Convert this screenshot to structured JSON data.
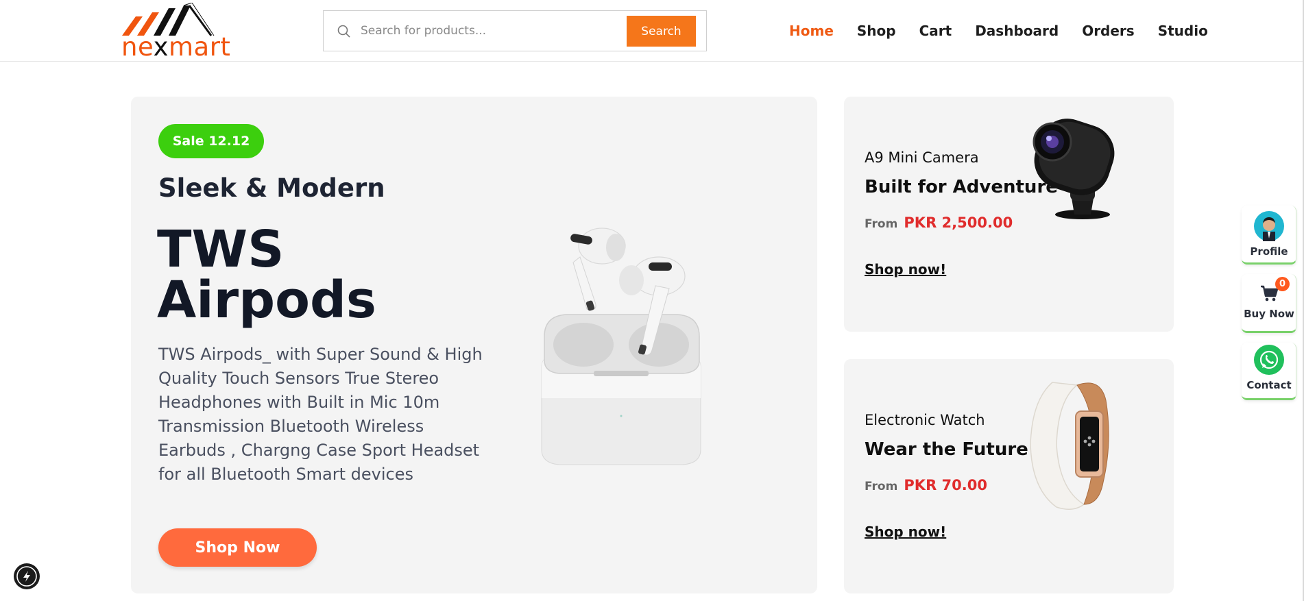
{
  "brand": {
    "name_prefix": "ne",
    "name_x": "x",
    "name_suffix": "mart",
    "accent_color": "#f0550f"
  },
  "search": {
    "placeholder": "Search for products...",
    "button_label": "Search"
  },
  "nav": {
    "items": [
      {
        "label": "Home",
        "active": true
      },
      {
        "label": "Shop"
      },
      {
        "label": "Cart"
      },
      {
        "label": "Dashboard"
      },
      {
        "label": "Orders"
      },
      {
        "label": "Studio"
      }
    ]
  },
  "hero": {
    "badge": "Sale 12.12",
    "subtitle": "Sleek & Modern",
    "title_line1": "TWS",
    "title_line2": "Airpods",
    "description": "TWS Airpods_ with Super Sound & High Quality Touch Sensors True Stereo Headphones with Built in Mic 10m Transmission Bluetooth Wireless Earbuds , Chargng Case Sport Headset for all Bluetooth Smart devices",
    "button_label": "Shop Now",
    "image_icon": "airpods-image"
  },
  "promos": [
    {
      "name": "A9 Mini Camera",
      "tagline": "Built for Adventure",
      "from_label": "From",
      "price": "PKR 2,500.00",
      "link_label": "Shop now!",
      "image_icon": "mini-camera-image"
    },
    {
      "name": "Electronic Watch",
      "tagline": "Wear the Future",
      "from_label": "From",
      "price": "PKR 70.00",
      "link_label": "Shop now!",
      "image_icon": "smart-watch-image"
    }
  ],
  "floating": {
    "profile_label": "Profile",
    "buy_label": "Buy Now",
    "cart_count": "0",
    "contact_label": "Contact"
  },
  "colors": {
    "badge_green": "#3ccf0e",
    "price_red": "#e02c2c",
    "cta_orange": "#ff6a3d",
    "search_orange": "#f5761a"
  }
}
